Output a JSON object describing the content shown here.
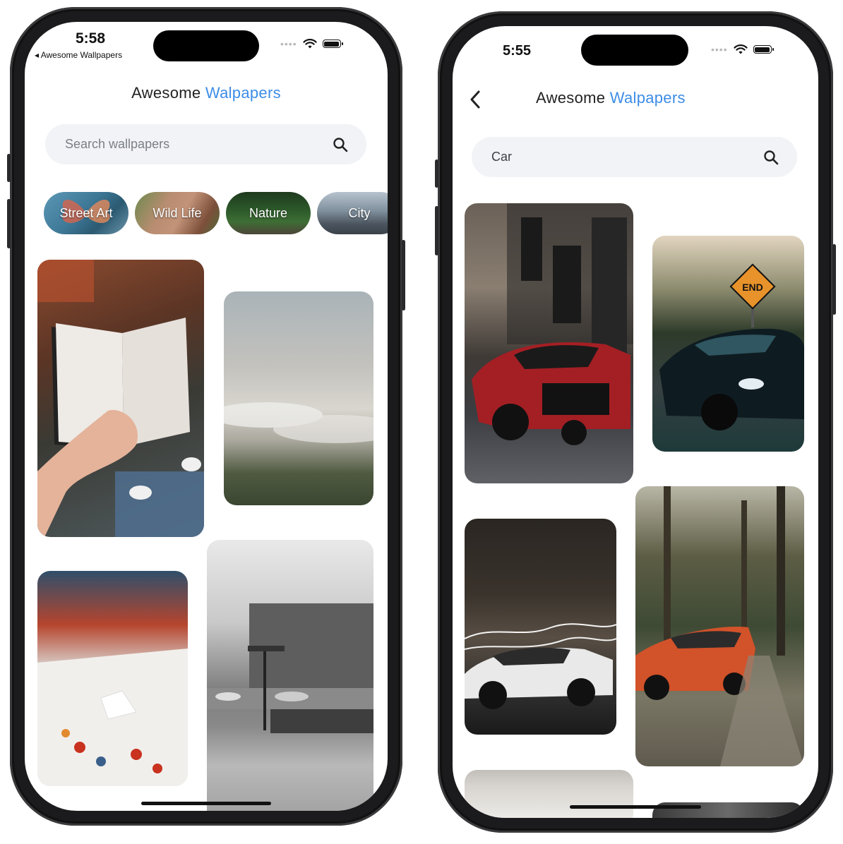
{
  "left": {
    "status": {
      "time": "5:58",
      "back_app": "◂ Awesome Wallpapers"
    },
    "title": {
      "main": "Awesome",
      "accent": "Walpapers"
    },
    "search": {
      "placeholder": "Search wallpapers"
    },
    "categories": [
      "Street Art",
      "Wild Life",
      "Nature",
      "City"
    ]
  },
  "right": {
    "status": {
      "time": "5:55"
    },
    "title": {
      "main": "Awesome",
      "accent": "Walpapers"
    },
    "search": {
      "value": "Car"
    },
    "road_sign": "END"
  },
  "colors": {
    "accent": "#3d8de6",
    "search_bg": "#f1f3f7",
    "frame": "#1b1b1d"
  },
  "icons": {
    "search": "search-icon",
    "back": "chevron-left-icon",
    "wifi": "wifi-icon",
    "battery": "battery-icon"
  }
}
